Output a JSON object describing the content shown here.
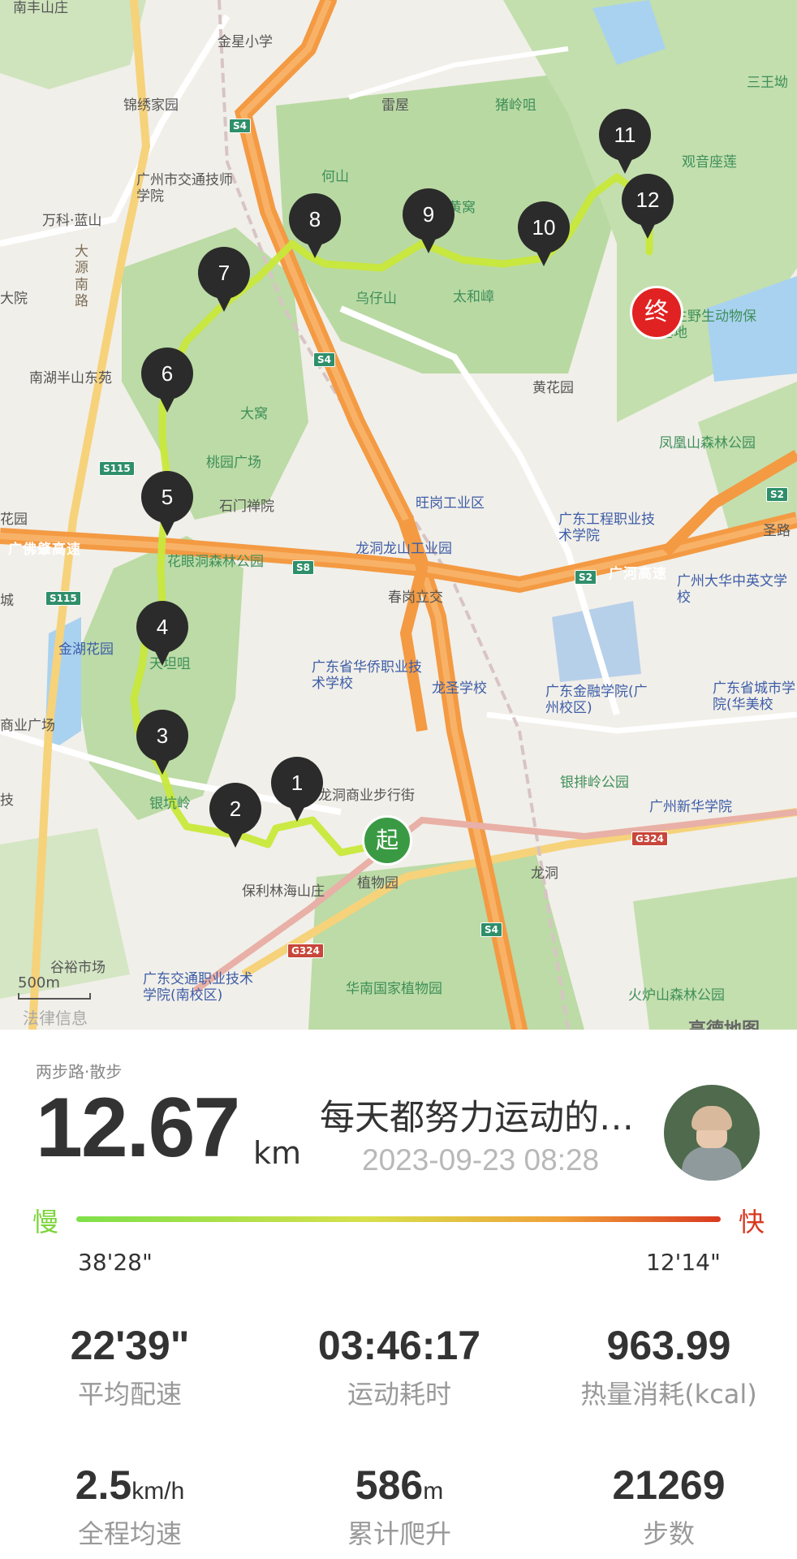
{
  "map": {
    "pois": [
      "南丰山庄",
      "金星小学",
      "锦绣家园",
      "广州市交通技师学院",
      "万科·蓝山",
      "大源南路",
      "大院",
      "南湖半山东苑",
      "雷屋",
      "猪岭咀",
      "何山",
      "黄窝",
      "三王坳",
      "观音座莲",
      "乌仔山",
      "太和嶂",
      "市水生野生动物保护基地",
      "黄花园",
      "大窝",
      "桃园广场",
      "石门禅院",
      "旺岗工业区",
      "广东工程职业技术学院",
      "龙洞龙山工业园",
      "凤凰山森林公园",
      "圣路",
      "花园",
      "广佛肇高速",
      "花眼洞森林公园",
      "春岗立交",
      "广河高速",
      "广州大华中英文学校",
      "城",
      "金湖花园",
      "天坦咀",
      "广东省华侨职业技术学校",
      "龙圣学校",
      "广东金融学院(广州校区)",
      "广东省城市学院(华美校",
      "商业广场",
      "技",
      "银坑岭",
      "龙洞商业步行街",
      "银排岭公园",
      "广州新华学院",
      "保利林海山庄",
      "植物园",
      "龙洞",
      "谷裕市场",
      "广东交通职业技术学院(南校区)",
      "华南国家植物园",
      "火炉山森林公园"
    ],
    "road_tags": [
      "S4",
      "S4",
      "S115",
      "S115",
      "S8",
      "S2",
      "S2",
      "S4",
      "G324",
      "G324"
    ],
    "markers": [
      "1",
      "2",
      "3",
      "4",
      "5",
      "6",
      "7",
      "8",
      "9",
      "10",
      "11",
      "12"
    ],
    "start_label": "起",
    "end_label": "终",
    "scale": "500m",
    "legal": "法律信息",
    "provider": "高德地图"
  },
  "summary": {
    "app": "两步路·散步",
    "distance": "12.67",
    "distance_unit": "km",
    "username": "每天都努力运动的…",
    "datetime": "2023-09-23 08:28",
    "slow_label": "慢",
    "fast_label": "快",
    "pace_slow": "38'28\"",
    "pace_fast": "12'14\""
  },
  "stats": [
    {
      "value": "22'39\"",
      "unit": "",
      "label": "平均配速"
    },
    {
      "value": "03:46:17",
      "unit": "",
      "label": "运动耗时"
    },
    {
      "value": "963.99",
      "unit": "",
      "label": "热量消耗(kcal)"
    },
    {
      "value": "2.5",
      "unit": "km/h",
      "label": "全程均速"
    },
    {
      "value": "586",
      "unit": "m",
      "label": "累计爬升"
    },
    {
      "value": "21269",
      "unit": "",
      "label": "步数"
    }
  ],
  "colors": {
    "slow": "#7bd43a",
    "fast": "#d9391f",
    "route": "#c8e83a",
    "start": "#3a9a44",
    "end": "#e12222",
    "highway": "#f39a43"
  }
}
